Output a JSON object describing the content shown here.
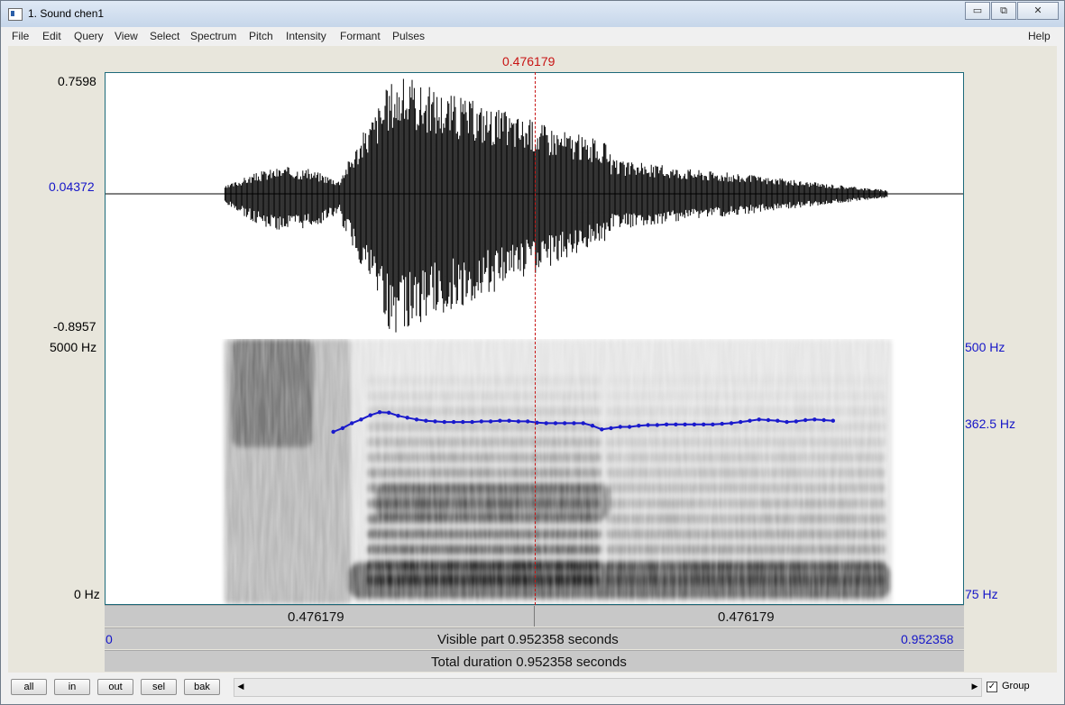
{
  "window": {
    "title": "1. Sound chen1",
    "controls": [
      "▭",
      "⧉",
      "✕"
    ]
  },
  "menu": {
    "items": [
      "File",
      "Edit",
      "Query",
      "View",
      "Select",
      "Spectrum",
      "Pitch",
      "Intensity",
      "Formant",
      "Pulses"
    ],
    "help": "Help"
  },
  "cursor": {
    "time_label": "0.476179",
    "time": 0.476179
  },
  "waveform": {
    "max_label": "0.7598",
    "zero_label": "0.04372",
    "min_label": "-0.8957"
  },
  "spectrogram": {
    "top_label": "5000 Hz",
    "bottom_label": "0 Hz"
  },
  "pitch": {
    "top_label": "500 Hz",
    "mid_label": "362.5 Hz",
    "bottom_label": "75 Hz",
    "color": "#1a1acc",
    "range_hz": [
      75,
      500
    ],
    "contour_hz": [
      352,
      358,
      366,
      372,
      379,
      384,
      383,
      378,
      375,
      372,
      370,
      369,
      368,
      368,
      368,
      368,
      369,
      369,
      370,
      370,
      369,
      369,
      367,
      366,
      366,
      366,
      366,
      366,
      362,
      356,
      358,
      360,
      360,
      362,
      363,
      363,
      364,
      364,
      364,
      364,
      364,
      364,
      365,
      366,
      368,
      370,
      372,
      371,
      370,
      368,
      369,
      371,
      372,
      371,
      370
    ],
    "contour_time_range": [
      0.253,
      0.808
    ]
  },
  "time_bar": {
    "left_label": "0.476179",
    "right_label": "0.476179"
  },
  "visible_bar": {
    "start_label": "0",
    "text": "Visible part 0.952358 seconds",
    "end_label": "0.952358"
  },
  "total_bar": {
    "text": "Total duration 0.952358 seconds"
  },
  "zoom_buttons": {
    "all": "all",
    "in": "in",
    "out": "out",
    "sel": "sel",
    "bak": "bak"
  },
  "scrollbar": {
    "left_arrow": "◀",
    "right_arrow": "▶"
  },
  "group": {
    "label": "Group",
    "checked": true,
    "check_mark": "✓"
  },
  "colors": {
    "cursor_line": "#c81414",
    "axis_blue": "#1515c8",
    "panel_border": "#1d6a7a"
  }
}
